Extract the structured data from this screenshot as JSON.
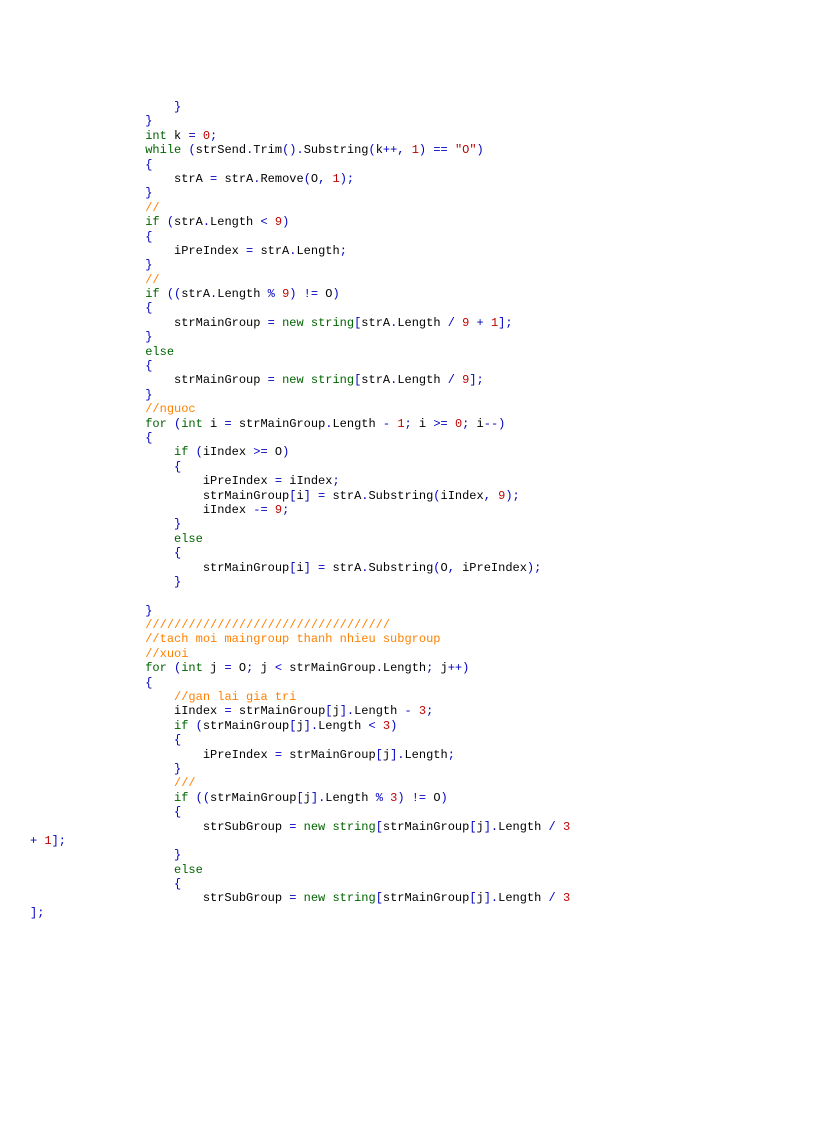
{
  "lines": [
    [
      {
        "t": "                    }",
        "c": "blue"
      }
    ],
    [
      {
        "t": "                }",
        "c": "blue"
      }
    ],
    [
      {
        "t": "                ",
        "c": "blue"
      },
      {
        "t": "int",
        "c": "green"
      },
      {
        "t": " ",
        "c": "blue"
      },
      {
        "t": "k ",
        "c": "black"
      },
      {
        "t": "= ",
        "c": "blue"
      },
      {
        "t": "0",
        "c": "red"
      },
      {
        "t": ";",
        "c": "blue"
      }
    ],
    [
      {
        "t": "                ",
        "c": "blue"
      },
      {
        "t": "while ",
        "c": "green"
      },
      {
        "t": "(",
        "c": "blue"
      },
      {
        "t": "strSend",
        "c": "black"
      },
      {
        "t": ".",
        "c": "blue"
      },
      {
        "t": "Trim",
        "c": "black"
      },
      {
        "t": "().",
        "c": "blue"
      },
      {
        "t": "Substring",
        "c": "black"
      },
      {
        "t": "(",
        "c": "blue"
      },
      {
        "t": "k",
        "c": "black"
      },
      {
        "t": "++, ",
        "c": "blue"
      },
      {
        "t": "1",
        "c": "red"
      },
      {
        "t": ") == ",
        "c": "blue"
      },
      {
        "t": "\"O\"",
        "c": "red"
      },
      {
        "t": ")",
        "c": "blue"
      }
    ],
    [
      {
        "t": "                {",
        "c": "blue"
      }
    ],
    [
      {
        "t": "                    ",
        "c": "blue"
      },
      {
        "t": "strA ",
        "c": "black"
      },
      {
        "t": "= ",
        "c": "blue"
      },
      {
        "t": "strA",
        "c": "black"
      },
      {
        "t": ".",
        "c": "blue"
      },
      {
        "t": "Remove",
        "c": "black"
      },
      {
        "t": "(",
        "c": "blue"
      },
      {
        "t": "O",
        "c": "black"
      },
      {
        "t": ", ",
        "c": "blue"
      },
      {
        "t": "1",
        "c": "red"
      },
      {
        "t": ");",
        "c": "blue"
      }
    ],
    [
      {
        "t": "                }",
        "c": "blue"
      }
    ],
    [
      {
        "t": "                ",
        "c": "blue"
      },
      {
        "t": "//",
        "c": "orange"
      }
    ],
    [
      {
        "t": "                ",
        "c": "blue"
      },
      {
        "t": "if ",
        "c": "green"
      },
      {
        "t": "(",
        "c": "blue"
      },
      {
        "t": "strA",
        "c": "black"
      },
      {
        "t": ".",
        "c": "blue"
      },
      {
        "t": "Length ",
        "c": "black"
      },
      {
        "t": "< ",
        "c": "blue"
      },
      {
        "t": "9",
        "c": "red"
      },
      {
        "t": ")",
        "c": "blue"
      }
    ],
    [
      {
        "t": "                {",
        "c": "blue"
      }
    ],
    [
      {
        "t": "                    ",
        "c": "blue"
      },
      {
        "t": "iPreIndex ",
        "c": "black"
      },
      {
        "t": "= ",
        "c": "blue"
      },
      {
        "t": "strA",
        "c": "black"
      },
      {
        "t": ".",
        "c": "blue"
      },
      {
        "t": "Length",
        "c": "black"
      },
      {
        "t": ";",
        "c": "blue"
      }
    ],
    [
      {
        "t": "                }",
        "c": "blue"
      }
    ],
    [
      {
        "t": "                ",
        "c": "blue"
      },
      {
        "t": "//",
        "c": "orange"
      }
    ],
    [
      {
        "t": "                ",
        "c": "blue"
      },
      {
        "t": "if ",
        "c": "green"
      },
      {
        "t": "((",
        "c": "blue"
      },
      {
        "t": "strA",
        "c": "black"
      },
      {
        "t": ".",
        "c": "blue"
      },
      {
        "t": "Length ",
        "c": "black"
      },
      {
        "t": "% ",
        "c": "blue"
      },
      {
        "t": "9",
        "c": "red"
      },
      {
        "t": ") != ",
        "c": "blue"
      },
      {
        "t": "O",
        "c": "black"
      },
      {
        "t": ")",
        "c": "blue"
      }
    ],
    [
      {
        "t": "                {",
        "c": "blue"
      }
    ],
    [
      {
        "t": "                    ",
        "c": "blue"
      },
      {
        "t": "strMainGroup ",
        "c": "black"
      },
      {
        "t": "= ",
        "c": "blue"
      },
      {
        "t": "new ",
        "c": "green"
      },
      {
        "t": "string",
        "c": "green"
      },
      {
        "t": "[",
        "c": "blue"
      },
      {
        "t": "strA",
        "c": "black"
      },
      {
        "t": ".",
        "c": "blue"
      },
      {
        "t": "Length ",
        "c": "black"
      },
      {
        "t": "/ ",
        "c": "blue"
      },
      {
        "t": "9 ",
        "c": "red"
      },
      {
        "t": "+ ",
        "c": "blue"
      },
      {
        "t": "1",
        "c": "red"
      },
      {
        "t": "];",
        "c": "blue"
      }
    ],
    [
      {
        "t": "                }",
        "c": "blue"
      }
    ],
    [
      {
        "t": "                ",
        "c": "blue"
      },
      {
        "t": "else",
        "c": "green"
      }
    ],
    [
      {
        "t": "                {",
        "c": "blue"
      }
    ],
    [
      {
        "t": "                    ",
        "c": "blue"
      },
      {
        "t": "strMainGroup ",
        "c": "black"
      },
      {
        "t": "= ",
        "c": "blue"
      },
      {
        "t": "new ",
        "c": "green"
      },
      {
        "t": "string",
        "c": "green"
      },
      {
        "t": "[",
        "c": "blue"
      },
      {
        "t": "strA",
        "c": "black"
      },
      {
        "t": ".",
        "c": "blue"
      },
      {
        "t": "Length ",
        "c": "black"
      },
      {
        "t": "/ ",
        "c": "blue"
      },
      {
        "t": "9",
        "c": "red"
      },
      {
        "t": "];",
        "c": "blue"
      }
    ],
    [
      {
        "t": "                }",
        "c": "blue"
      }
    ],
    [
      {
        "t": "                ",
        "c": "blue"
      },
      {
        "t": "//nguoc",
        "c": "orange"
      }
    ],
    [
      {
        "t": "                ",
        "c": "blue"
      },
      {
        "t": "for ",
        "c": "green"
      },
      {
        "t": "(",
        "c": "blue"
      },
      {
        "t": "int ",
        "c": "green"
      },
      {
        "t": "i ",
        "c": "black"
      },
      {
        "t": "= ",
        "c": "blue"
      },
      {
        "t": "strMainGroup",
        "c": "black"
      },
      {
        "t": ".",
        "c": "blue"
      },
      {
        "t": "Length ",
        "c": "black"
      },
      {
        "t": "- ",
        "c": "blue"
      },
      {
        "t": "1",
        "c": "red"
      },
      {
        "t": "; ",
        "c": "blue"
      },
      {
        "t": "i ",
        "c": "black"
      },
      {
        "t": ">= ",
        "c": "blue"
      },
      {
        "t": "0",
        "c": "red"
      },
      {
        "t": "; ",
        "c": "blue"
      },
      {
        "t": "i",
        "c": "black"
      },
      {
        "t": "--)",
        "c": "blue"
      }
    ],
    [
      {
        "t": "                {",
        "c": "blue"
      }
    ],
    [
      {
        "t": "                    ",
        "c": "blue"
      },
      {
        "t": "if ",
        "c": "green"
      },
      {
        "t": "(",
        "c": "blue"
      },
      {
        "t": "iIndex ",
        "c": "black"
      },
      {
        "t": ">= ",
        "c": "blue"
      },
      {
        "t": "O",
        "c": "black"
      },
      {
        "t": ")",
        "c": "blue"
      }
    ],
    [
      {
        "t": "                    {",
        "c": "blue"
      }
    ],
    [
      {
        "t": "                        ",
        "c": "blue"
      },
      {
        "t": "iPreIndex ",
        "c": "black"
      },
      {
        "t": "= ",
        "c": "blue"
      },
      {
        "t": "iIndex",
        "c": "black"
      },
      {
        "t": ";",
        "c": "blue"
      }
    ],
    [
      {
        "t": "                        ",
        "c": "blue"
      },
      {
        "t": "strMainGroup",
        "c": "black"
      },
      {
        "t": "[",
        "c": "blue"
      },
      {
        "t": "i",
        "c": "black"
      },
      {
        "t": "] = ",
        "c": "blue"
      },
      {
        "t": "strA",
        "c": "black"
      },
      {
        "t": ".",
        "c": "blue"
      },
      {
        "t": "Substring",
        "c": "black"
      },
      {
        "t": "(",
        "c": "blue"
      },
      {
        "t": "iIndex",
        "c": "black"
      },
      {
        "t": ", ",
        "c": "blue"
      },
      {
        "t": "9",
        "c": "red"
      },
      {
        "t": ");",
        "c": "blue"
      }
    ],
    [
      {
        "t": "                        ",
        "c": "blue"
      },
      {
        "t": "iIndex ",
        "c": "black"
      },
      {
        "t": "-= ",
        "c": "blue"
      },
      {
        "t": "9",
        "c": "red"
      },
      {
        "t": ";",
        "c": "blue"
      }
    ],
    [
      {
        "t": "                    }",
        "c": "blue"
      }
    ],
    [
      {
        "t": "                    ",
        "c": "blue"
      },
      {
        "t": "else",
        "c": "green"
      }
    ],
    [
      {
        "t": "                    {",
        "c": "blue"
      }
    ],
    [
      {
        "t": "                        ",
        "c": "blue"
      },
      {
        "t": "strMainGroup",
        "c": "black"
      },
      {
        "t": "[",
        "c": "blue"
      },
      {
        "t": "i",
        "c": "black"
      },
      {
        "t": "] = ",
        "c": "blue"
      },
      {
        "t": "strA",
        "c": "black"
      },
      {
        "t": ".",
        "c": "blue"
      },
      {
        "t": "Substring",
        "c": "black"
      },
      {
        "t": "(",
        "c": "blue"
      },
      {
        "t": "O",
        "c": "black"
      },
      {
        "t": ", ",
        "c": "blue"
      },
      {
        "t": "iPreIndex",
        "c": "black"
      },
      {
        "t": ");",
        "c": "blue"
      }
    ],
    [
      {
        "t": "                    }",
        "c": "blue"
      }
    ],
    [
      {
        "t": " ",
        "c": "blue"
      }
    ],
    [
      {
        "t": "                }",
        "c": "blue"
      }
    ],
    [
      {
        "t": "                ",
        "c": "blue"
      },
      {
        "t": "//////////////////////////////////",
        "c": "orange"
      }
    ],
    [
      {
        "t": "                ",
        "c": "blue"
      },
      {
        "t": "//tach moi maingroup thanh nhieu subgroup",
        "c": "orange"
      }
    ],
    [
      {
        "t": "                ",
        "c": "blue"
      },
      {
        "t": "//xuoi",
        "c": "orange"
      }
    ],
    [
      {
        "t": "                ",
        "c": "blue"
      },
      {
        "t": "for ",
        "c": "green"
      },
      {
        "t": "(",
        "c": "blue"
      },
      {
        "t": "int ",
        "c": "green"
      },
      {
        "t": "j ",
        "c": "black"
      },
      {
        "t": "= ",
        "c": "blue"
      },
      {
        "t": "O",
        "c": "black"
      },
      {
        "t": "; ",
        "c": "blue"
      },
      {
        "t": "j ",
        "c": "black"
      },
      {
        "t": "< ",
        "c": "blue"
      },
      {
        "t": "strMainGroup",
        "c": "black"
      },
      {
        "t": ".",
        "c": "blue"
      },
      {
        "t": "Length",
        "c": "black"
      },
      {
        "t": "; ",
        "c": "blue"
      },
      {
        "t": "j",
        "c": "black"
      },
      {
        "t": "++)",
        "c": "blue"
      }
    ],
    [
      {
        "t": "                {",
        "c": "blue"
      }
    ],
    [
      {
        "t": "                    ",
        "c": "blue"
      },
      {
        "t": "//gan lai gia tri",
        "c": "orange"
      }
    ],
    [
      {
        "t": "                    ",
        "c": "blue"
      },
      {
        "t": "iIndex ",
        "c": "black"
      },
      {
        "t": "= ",
        "c": "blue"
      },
      {
        "t": "strMainGroup",
        "c": "black"
      },
      {
        "t": "[",
        "c": "blue"
      },
      {
        "t": "j",
        "c": "black"
      },
      {
        "t": "].",
        "c": "blue"
      },
      {
        "t": "Length ",
        "c": "black"
      },
      {
        "t": "- ",
        "c": "blue"
      },
      {
        "t": "3",
        "c": "red"
      },
      {
        "t": ";",
        "c": "blue"
      }
    ],
    [
      {
        "t": "                    ",
        "c": "blue"
      },
      {
        "t": "if ",
        "c": "green"
      },
      {
        "t": "(",
        "c": "blue"
      },
      {
        "t": "strMainGroup",
        "c": "black"
      },
      {
        "t": "[",
        "c": "blue"
      },
      {
        "t": "j",
        "c": "black"
      },
      {
        "t": "].",
        "c": "blue"
      },
      {
        "t": "Length ",
        "c": "black"
      },
      {
        "t": "< ",
        "c": "blue"
      },
      {
        "t": "3",
        "c": "red"
      },
      {
        "t": ")",
        "c": "blue"
      }
    ],
    [
      {
        "t": "                    {",
        "c": "blue"
      }
    ],
    [
      {
        "t": "                        ",
        "c": "blue"
      },
      {
        "t": "iPreIndex ",
        "c": "black"
      },
      {
        "t": "= ",
        "c": "blue"
      },
      {
        "t": "strMainGroup",
        "c": "black"
      },
      {
        "t": "[",
        "c": "blue"
      },
      {
        "t": "j",
        "c": "black"
      },
      {
        "t": "].",
        "c": "blue"
      },
      {
        "t": "Length",
        "c": "black"
      },
      {
        "t": ";",
        "c": "blue"
      }
    ],
    [
      {
        "t": "                    }",
        "c": "blue"
      }
    ],
    [
      {
        "t": "                    ",
        "c": "blue"
      },
      {
        "t": "///",
        "c": "orange"
      }
    ],
    [
      {
        "t": "                    ",
        "c": "blue"
      },
      {
        "t": "if ",
        "c": "green"
      },
      {
        "t": "((",
        "c": "blue"
      },
      {
        "t": "strMainGroup",
        "c": "black"
      },
      {
        "t": "[",
        "c": "blue"
      },
      {
        "t": "j",
        "c": "black"
      },
      {
        "t": "].",
        "c": "blue"
      },
      {
        "t": "Length ",
        "c": "black"
      },
      {
        "t": "% ",
        "c": "blue"
      },
      {
        "t": "3",
        "c": "red"
      },
      {
        "t": ") != ",
        "c": "blue"
      },
      {
        "t": "O",
        "c": "black"
      },
      {
        "t": ")",
        "c": "blue"
      }
    ],
    [
      {
        "t": "                    {",
        "c": "blue"
      }
    ],
    [
      {
        "t": "                        ",
        "c": "blue"
      },
      {
        "t": "strSubGroup ",
        "c": "black"
      },
      {
        "t": "= ",
        "c": "blue"
      },
      {
        "t": "new ",
        "c": "green"
      },
      {
        "t": "string",
        "c": "green"
      },
      {
        "t": "[",
        "c": "blue"
      },
      {
        "t": "strMainGroup",
        "c": "black"
      },
      {
        "t": "[",
        "c": "blue"
      },
      {
        "t": "j",
        "c": "black"
      },
      {
        "t": "].",
        "c": "blue"
      },
      {
        "t": "Length ",
        "c": "black"
      },
      {
        "t": "/ ",
        "c": "blue"
      },
      {
        "t": "3 ",
        "c": "red"
      }
    ],
    [
      {
        "t": "+ ",
        "c": "blue"
      },
      {
        "t": "1",
        "c": "red"
      },
      {
        "t": "];",
        "c": "blue"
      }
    ],
    [
      {
        "t": "                    }",
        "c": "blue"
      }
    ],
    [
      {
        "t": "                    ",
        "c": "blue"
      },
      {
        "t": "else",
        "c": "green"
      }
    ],
    [
      {
        "t": "                    {",
        "c": "blue"
      }
    ],
    [
      {
        "t": "                        ",
        "c": "blue"
      },
      {
        "t": "strSubGroup ",
        "c": "black"
      },
      {
        "t": "= ",
        "c": "blue"
      },
      {
        "t": "new ",
        "c": "green"
      },
      {
        "t": "string",
        "c": "green"
      },
      {
        "t": "[",
        "c": "blue"
      },
      {
        "t": "strMainGroup",
        "c": "black"
      },
      {
        "t": "[",
        "c": "blue"
      },
      {
        "t": "j",
        "c": "black"
      },
      {
        "t": "].",
        "c": "blue"
      },
      {
        "t": "Length ",
        "c": "black"
      },
      {
        "t": "/ ",
        "c": "blue"
      },
      {
        "t": "3 ",
        "c": "red"
      }
    ],
    [
      {
        "t": "];",
        "c": "blue"
      }
    ]
  ]
}
